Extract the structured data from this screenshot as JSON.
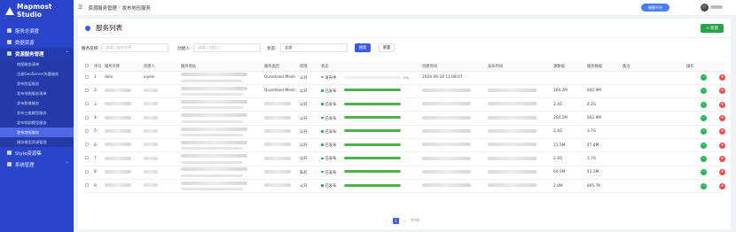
{
  "app": {
    "name": "Mapmost Studio"
  },
  "sidebar": {
    "items": [
      {
        "label": "服务总调度",
        "open": false
      },
      {
        "label": "数据资源",
        "open": false
      },
      {
        "label": "资源服务管理",
        "open": true
      },
      {
        "label": "Style资源集",
        "open": false
      },
      {
        "label": "系统管理",
        "open": false
      }
    ],
    "submenu": [
      {
        "label": "地图服务清单",
        "active": false
      },
      {
        "label": "注册GeoServer矢量服务",
        "active": false
      },
      {
        "label": "发布图层服务",
        "active": false
      },
      {
        "label": "发布地图服务清单",
        "active": false
      },
      {
        "label": "发布影像服务",
        "active": false
      },
      {
        "label": "发布三维模型服务",
        "active": false
      },
      {
        "label": "发布倾斜模型服务",
        "active": false
      },
      {
        "label": "发布地形服务",
        "active": true
      },
      {
        "label": "模仿模型资源管理",
        "active": false
      }
    ]
  },
  "header": {
    "breadcrumb_root": "资源服务管理",
    "breadcrumb_current": "发布地形服务",
    "portal_button": "制图平台"
  },
  "card": {
    "title": "服务列表",
    "create_button": "+ 新建"
  },
  "filters": {
    "name_label": "服务名称:",
    "name_placeholder": "请输入服务名称",
    "creator_label": "创建人:",
    "creator_placeholder": "请输入创建人",
    "status_label": "状态:",
    "status_value": "全部",
    "search_button": "搜索",
    "reset_button": "重置"
  },
  "table": {
    "columns": [
      "序号",
      "服务名称",
      "创建人",
      "服务地址",
      "服务类型",
      "权限",
      "状态",
      "",
      "创建时间",
      "发布时间",
      "源数据",
      "服务数据",
      "备注",
      "操作"
    ],
    "rows": [
      {
        "index": "1",
        "name": "dele",
        "creator": "xiyed",
        "type": "Quantized-Mesh",
        "perm": "公开",
        "status": "发布中",
        "progress": 0,
        "progress_label": "0%",
        "created": "2024-06-28 11:08:07",
        "published": "",
        "source": "",
        "service": "",
        "pending": true
      },
      {
        "index": "2",
        "name": "",
        "creator": "",
        "type": "Quantized-Mesh",
        "perm": "公开",
        "status": "已发布",
        "progress": 100,
        "progress_label": "",
        "created": "",
        "published": "",
        "source": "264.2M",
        "service": "842.9M",
        "pending": false
      },
      {
        "index": "3",
        "name": "",
        "creator": "",
        "type": "",
        "perm": "公开",
        "status": "已发布",
        "progress": 100,
        "progress_label": "",
        "created": "",
        "published": "",
        "source": "2.4G",
        "service": "4.2G",
        "pending": false
      },
      {
        "index": "4",
        "name": "",
        "creator": "",
        "type": "",
        "perm": "公开",
        "status": "已发布",
        "progress": 100,
        "progress_label": "",
        "created": "",
        "published": "",
        "source": "264.2M",
        "service": "842.9M",
        "pending": false
      },
      {
        "index": "5",
        "name": "",
        "creator": "",
        "type": "",
        "perm": "公开",
        "status": "已发布",
        "progress": 100,
        "progress_label": "",
        "created": "",
        "published": "",
        "source": "2.4G",
        "service": "3.7G",
        "pending": false
      },
      {
        "index": "6",
        "name": "",
        "creator": "",
        "type": "",
        "perm": "公开",
        "status": "已发布",
        "progress": 100,
        "progress_label": "",
        "created": "",
        "published": "",
        "source": "11.5M",
        "service": "47.8M",
        "pending": false
      },
      {
        "index": "7",
        "name": "",
        "creator": "",
        "type": "",
        "perm": "公开",
        "status": "已发布",
        "progress": 100,
        "progress_label": "",
        "created": "",
        "published": "",
        "source": "2.4G",
        "service": "3.7G",
        "pending": false
      },
      {
        "index": "8",
        "name": "",
        "creator": "",
        "type": "",
        "perm": "私有",
        "status": "已发布",
        "progress": 100,
        "progress_label": "",
        "created": "",
        "published": "",
        "source": "64.5M",
        "service": "42.3M",
        "pending": false
      },
      {
        "index": "9",
        "name": "",
        "creator": "",
        "type": "",
        "perm": "公开",
        "status": "已发布",
        "progress": 100,
        "progress_label": "",
        "created": "",
        "published": "",
        "source": "2.9M",
        "service": "895.7K",
        "pending": false
      }
    ]
  },
  "pagination": {
    "current": "1",
    "total": "共9条"
  },
  "colors": {
    "sidebar": "#2a45c9",
    "primary": "#3d5ae0",
    "success": "#27a34a",
    "danger": "#f04d4d"
  }
}
